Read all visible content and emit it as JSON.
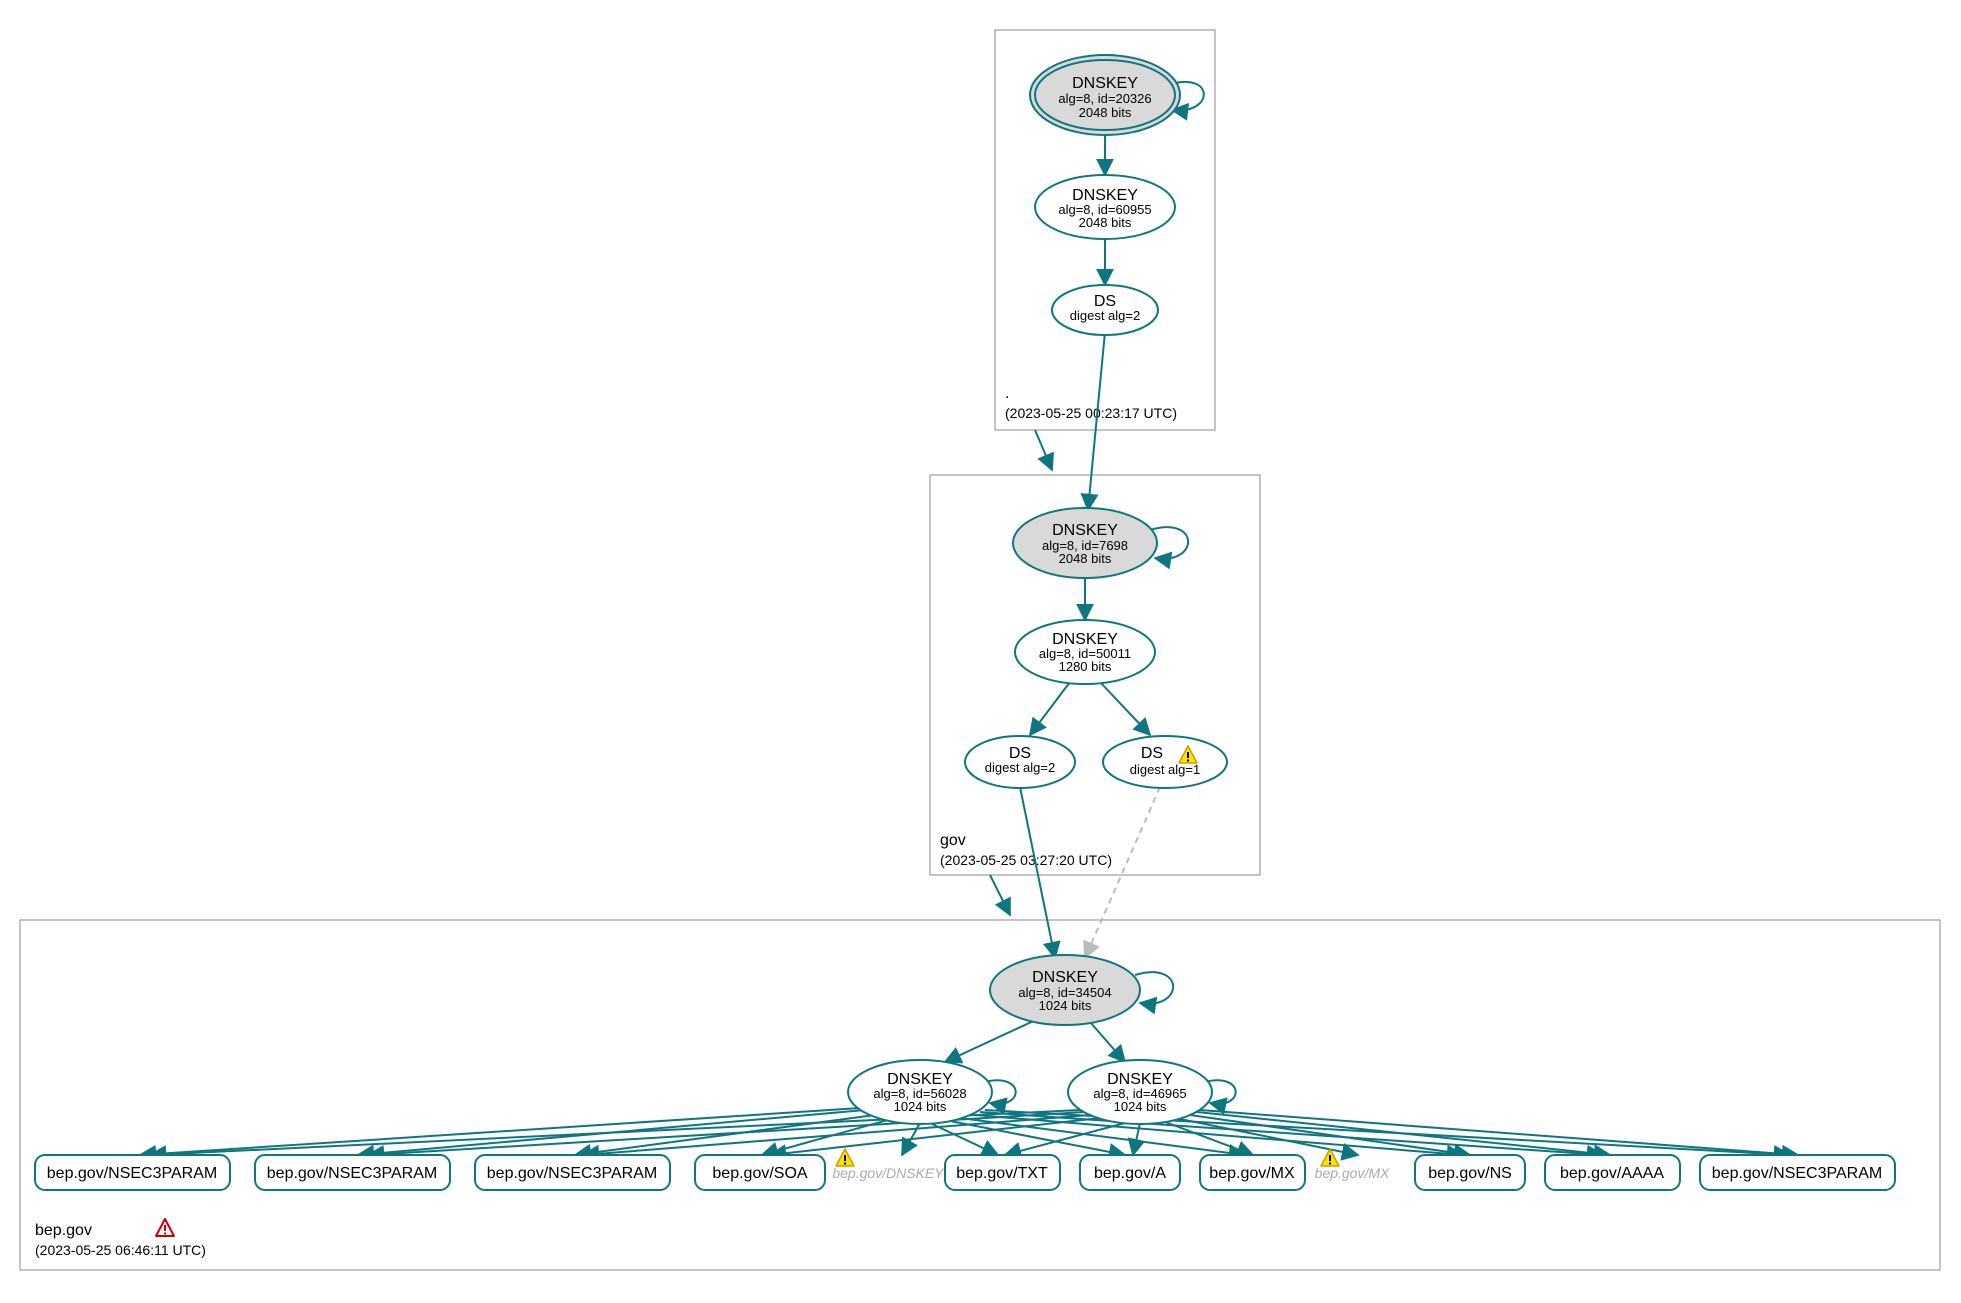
{
  "colors": {
    "teal": "#0f7680",
    "grayFill": "#d9d9d9",
    "white": "#ffffff",
    "boxStroke": "#888888",
    "warnFill": "#ffe100",
    "warnStroke": "#c9a000",
    "errStroke": "#cc0000",
    "ghost": "#aaaaaa"
  },
  "zones": {
    "root": {
      "label": ".",
      "time": "(2023-05-25 00:23:17 UTC)"
    },
    "gov": {
      "label": "gov",
      "time": "(2023-05-25 03:27:20 UTC)"
    },
    "bep": {
      "label": "bep.gov",
      "time": "(2023-05-25 06:46:11 UTC)"
    }
  },
  "nodes": {
    "root_ksk": {
      "title": "DNSKEY",
      "line1": "alg=8, id=20326",
      "line2": "2048 bits"
    },
    "root_zsk": {
      "title": "DNSKEY",
      "line1": "alg=8, id=60955",
      "line2": "2048 bits"
    },
    "root_ds": {
      "title": "DS",
      "line1": "digest alg=2"
    },
    "gov_ksk": {
      "title": "DNSKEY",
      "line1": "alg=8, id=7698",
      "line2": "2048 bits"
    },
    "gov_zsk": {
      "title": "DNSKEY",
      "line1": "alg=8, id=50011",
      "line2": "1280 bits"
    },
    "gov_ds1": {
      "title": "DS",
      "line1": "digest alg=2"
    },
    "gov_ds2": {
      "title": "DS",
      "line1": "digest alg=1"
    },
    "bep_ksk": {
      "title": "DNSKEY",
      "line1": "alg=8, id=34504",
      "line2": "1024 bits"
    },
    "bep_zsk1": {
      "title": "DNSKEY",
      "line1": "alg=8, id=56028",
      "line2": "1024 bits"
    },
    "bep_zsk2": {
      "title": "DNSKEY",
      "line1": "alg=8, id=46965",
      "line2": "1024 bits"
    }
  },
  "records": {
    "r1": "bep.gov/NSEC3PARAM",
    "r2": "bep.gov/NSEC3PARAM",
    "r3": "bep.gov/NSEC3PARAM",
    "r4": "bep.gov/SOA",
    "g1": "bep.gov/DNSKEY",
    "r5": "bep.gov/TXT",
    "r6": "bep.gov/A",
    "r7": "bep.gov/MX",
    "g2": "bep.gov/MX",
    "r8": "bep.gov/NS",
    "r9": "bep.gov/AAAA",
    "r10": "bep.gov/NSEC3PARAM"
  }
}
